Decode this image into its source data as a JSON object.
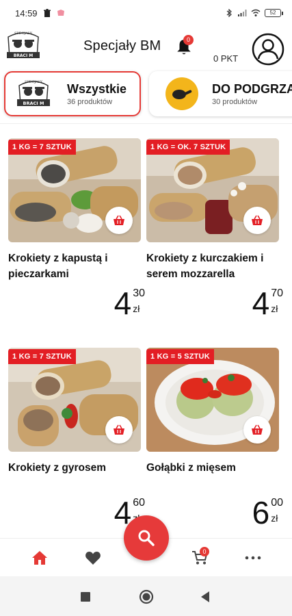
{
  "status_bar": {
    "time": "14:59",
    "battery": "52"
  },
  "header": {
    "title": "Specjały BM",
    "notifications_count": "0",
    "points_label": "0 PKT",
    "logo_text": "SPECJAŁY BRACI M"
  },
  "categories": [
    {
      "name": "Wszystkie",
      "count": "36 produktów",
      "active": true
    },
    {
      "name": "DO PODGRZA",
      "count": "30 produktów",
      "active": false
    }
  ],
  "products": [
    {
      "name": "Krokiety z kapustą i pieczarkami",
      "tag": "1 KG = 7 SZTUK",
      "price_int": "4",
      "price_dec": "30",
      "currency": "zł"
    },
    {
      "name": "Krokiety z kurczakiem i serem mozzarella",
      "tag": "1 KG = OK. 7 SZTUK",
      "price_int": "4",
      "price_dec": "70",
      "currency": "zł"
    },
    {
      "name": "Krokiety z gyrosem",
      "tag": "1 KG = 7 SZTUK",
      "price_int": "4",
      "price_dec": "60",
      "currency": "zł"
    },
    {
      "name": "Gołąbki z mięsem",
      "tag": "1 KG = 5 SZTUK",
      "price_int": "6",
      "price_dec": "00",
      "currency": "zł"
    }
  ],
  "bottom_nav": {
    "items": [
      "home-icon",
      "heart-icon",
      "search-icon",
      "cart-icon",
      "more-icon"
    ],
    "cart_count": "0"
  },
  "colors": {
    "accent": "#e31e24",
    "fab": "#e63a3a",
    "category_icon_bg": "#f3b51b"
  }
}
